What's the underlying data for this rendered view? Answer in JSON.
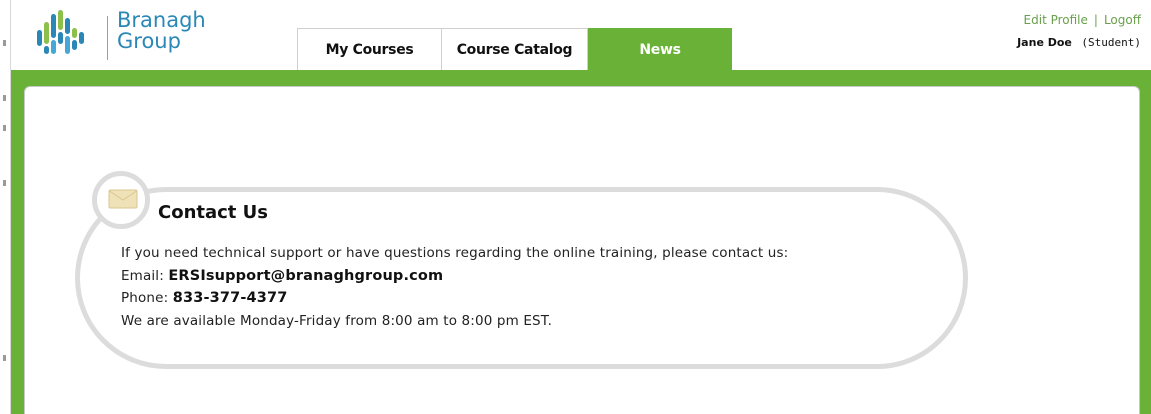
{
  "header": {
    "logo_line1": "Branagh",
    "logo_line2": "Group",
    "tabs": [
      {
        "label": "My Courses",
        "active": false
      },
      {
        "label": "Course Catalog",
        "active": false
      },
      {
        "label": "News",
        "active": true
      }
    ],
    "links": {
      "edit_profile": "Edit Profile",
      "separator": "|",
      "logoff": "Logoff"
    },
    "user": {
      "name": "Jane Doe",
      "role": "(Student)"
    }
  },
  "contact": {
    "icon": "envelope-icon",
    "title": "Contact Us",
    "intro": "If you need technical support or have questions regarding the online training, please contact us:",
    "email_label": "Email:",
    "email_value": "ERSIsupport@branaghgroup.com",
    "phone_label": "Phone:",
    "phone_value": "833-377-4377",
    "hours": "We are available Monday-Friday from 8:00 am to 8:00 pm EST."
  },
  "colors": {
    "brand_green": "#6ab237",
    "logo_blue": "#2a87b6",
    "link_green": "#6aa04c",
    "bubble_border": "#dcdcdc"
  }
}
